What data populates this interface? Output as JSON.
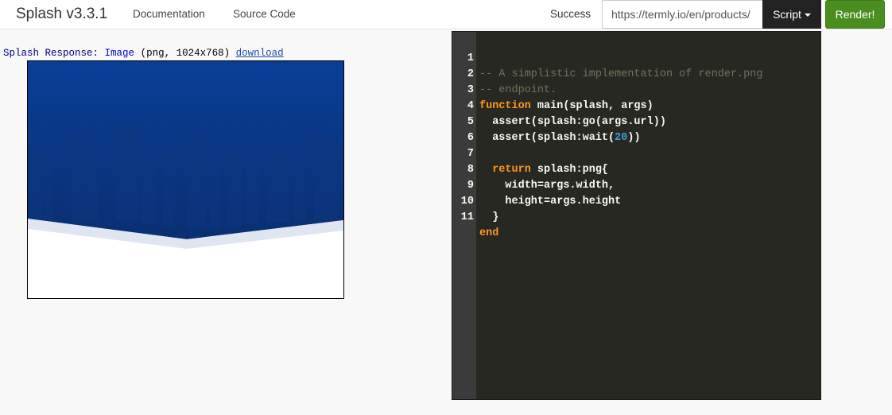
{
  "navbar": {
    "brand": "Splash v3.3.1",
    "links": [
      "Documentation",
      "Source Code"
    ],
    "status": "Success",
    "url_value": "https://termly.io/en/products/",
    "script_label": "Script",
    "render_label": "Render!"
  },
  "response": {
    "label": "Splash Response:",
    "type": "Image",
    "meta": "(png, 1024x768)",
    "download": "download"
  },
  "editor": {
    "line_numbers": [
      "1",
      "2",
      "3",
      "4",
      "5",
      "6",
      "7",
      "8",
      "9",
      "10",
      "11"
    ],
    "lines": [
      "-- A simplistic implementation of render.png",
      "-- endpoint.",
      "function main(splash, args)",
      "  assert(splash:go(args.url))",
      "  assert(splash:wait(20))",
      "",
      "  return splash:png{",
      "    width=args.width,",
      "    height=args.height",
      "  }",
      "end"
    ]
  },
  "colors": {
    "render_button": "#4a8e20",
    "script_button": "#222222",
    "editor_bg": "#272822",
    "keyword": "#fd971f",
    "comment": "#75715e",
    "number": "#3aa0d8",
    "image_blue": "#0a3a8c"
  }
}
